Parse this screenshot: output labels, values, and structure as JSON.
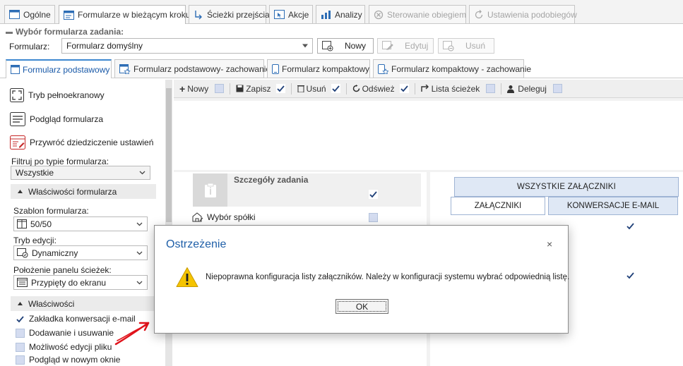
{
  "tabs": {
    "general": "Ogólne",
    "forms_current_step": "Formularze w bieżącym kroku",
    "transition_paths": "Ścieżki przejścia",
    "actions": "Akcje",
    "analyses": "Analizy",
    "flow_control": "Sterowanie obiegiem",
    "subflow_settings": "Ustawienia podobiegów"
  },
  "form_selection": {
    "section_title": "Wybór formularza zadania:",
    "label": "Formularz:",
    "value": "Formularz domyślny",
    "new_button": "Nowy",
    "edit_button": "Edytuj",
    "delete_button": "Usuń"
  },
  "subtabs": {
    "basic": "Formularz podstawowy",
    "basic_behavior": "Formularz podstawowy- zachowanie",
    "compact": "Formularz kompaktowy",
    "compact_behavior": "Formularz kompaktowy - zachowanie"
  },
  "left_panel": {
    "fullscreen": "Tryb pełnoekranowy",
    "preview": "Podgląd formularza",
    "restore": "Przywróć dziedziczenie ustawień",
    "filter_label": "Filtruj po typie formularza:",
    "filter_value": "Wszystkie",
    "form_props_header": "Właściwości formularza",
    "template_label": "Szablon formularza:",
    "template_value": "50/50",
    "edit_mode_label": "Tryb edycji:",
    "edit_mode_value": "Dynamiczny",
    "path_panel_label": "Położenie panelu ścieżek:",
    "path_panel_value": "Przypięty do ekranu",
    "props_header": "Właściwości",
    "checkboxes": [
      {
        "label": "Zakładka konwersacji e-mail",
        "checked": true
      },
      {
        "label": "Dodawanie i usuwanie",
        "checked": false
      },
      {
        "label": "Możliwość edycji pliku",
        "checked": false
      },
      {
        "label": "Podgląd w nowym oknie",
        "checked": false
      }
    ]
  },
  "toolbar": {
    "new": "Nowy",
    "save": "Zapisz",
    "delete": "Usuń",
    "refresh": "Odśwież",
    "path_list": "Lista ścieżek",
    "delegate": "Deleguj"
  },
  "form_canvas": {
    "task_details": "Szczegóły zadania",
    "company_choice": "Wybór spółki"
  },
  "attachments": {
    "all": "WSZYSTKIE ZAŁĄCZNIKI",
    "attachments_tab": "ZAŁĄCZNIKI",
    "email_tab": "KONWERSACJE E-MAIL"
  },
  "dialog": {
    "title": "Ostrzeżenie",
    "message": "Niepoprawna konfiguracja listy załączników. Należy w konfiguracji systemu wybrać odpowiednią listę.",
    "ok": "OK",
    "close": "×"
  },
  "colors": {
    "accent": "#1a5aa8",
    "warning": "#f5c400",
    "annotation": "#e0121a"
  }
}
